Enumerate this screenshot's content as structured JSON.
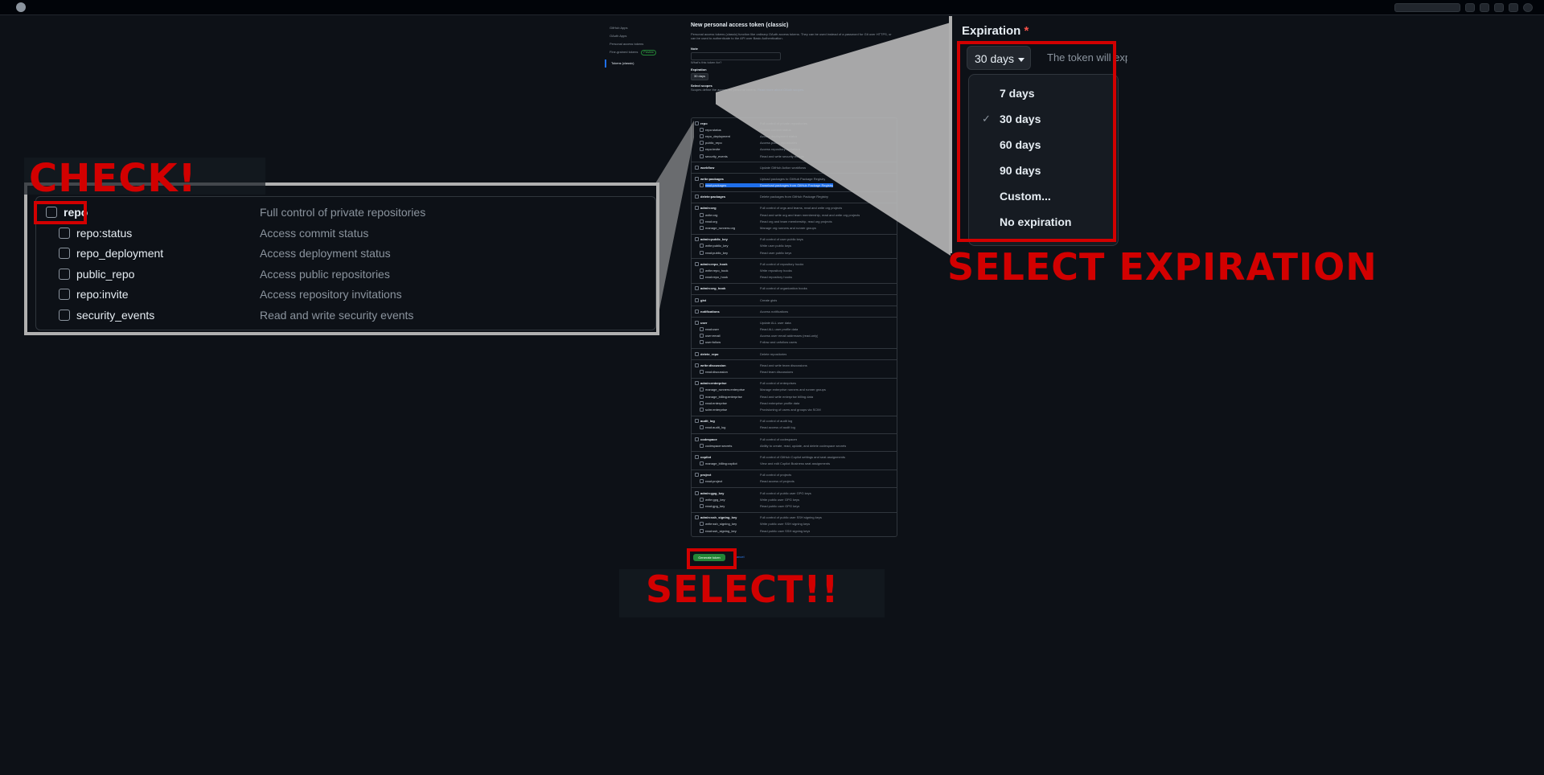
{
  "top_bar": {
    "logo_icon": "github-icon"
  },
  "left_nav": {
    "items": [
      "GitHub Apps",
      "OAuth Apps",
      "Personal access tokens",
      "Fine-grained tokens",
      "Tokens (classic)"
    ],
    "preview_badge": "Preview"
  },
  "form": {
    "heading": "New personal access token (classic)",
    "intro": "Personal access tokens (classic) function like ordinary OAuth access tokens. They can be used instead of a password for Git over HTTPS, or can be used to authenticate to the API over Basic Authentication.",
    "note_label": "Note",
    "note_hint": "What's this token for?",
    "expiration_label": "Expiration",
    "expiration_value": "30 days",
    "select_scopes_label": "Select scopes",
    "scopes_intro": "Scopes define the access for personal tokens.",
    "scopes_link": "Read more about OAuth scopes.",
    "generate_button": "Generate token",
    "cancel_link": "Cancel"
  },
  "scopes": [
    {
      "name": "repo",
      "desc": "Full control of private repositories",
      "children": [
        {
          "name": "repo:status",
          "desc": "Access commit status"
        },
        {
          "name": "repo_deployment",
          "desc": "Access deployment status"
        },
        {
          "name": "public_repo",
          "desc": "Access public repositories"
        },
        {
          "name": "repo:invite",
          "desc": "Access repository invitations"
        },
        {
          "name": "security_events",
          "desc": "Read and write security events"
        }
      ]
    },
    {
      "name": "workflow",
      "desc": "Update GitHub Action workflows",
      "children": []
    },
    {
      "name": "write:packages",
      "desc": "Upload packages to GitHub Package Registry",
      "children": [
        {
          "name": "read:packages",
          "desc": "Download packages from GitHub Package Registry",
          "highlight": true
        }
      ]
    },
    {
      "name": "delete:packages",
      "desc": "Delete packages from GitHub Package Registry",
      "children": []
    },
    {
      "name": "admin:org",
      "desc": "Full control of orgs and teams, read and write org projects",
      "children": [
        {
          "name": "write:org",
          "desc": "Read and write org and team membership, read and write org projects"
        },
        {
          "name": "read:org",
          "desc": "Read org and team membership, read org projects"
        },
        {
          "name": "manage_runners:org",
          "desc": "Manage org runners and runner groups"
        }
      ]
    },
    {
      "name": "admin:public_key",
      "desc": "Full control of user public keys",
      "children": [
        {
          "name": "write:public_key",
          "desc": "Write user public keys"
        },
        {
          "name": "read:public_key",
          "desc": "Read user public keys"
        }
      ]
    },
    {
      "name": "admin:repo_hook",
      "desc": "Full control of repository hooks",
      "children": [
        {
          "name": "write:repo_hook",
          "desc": "Write repository hooks"
        },
        {
          "name": "read:repo_hook",
          "desc": "Read repository hooks"
        }
      ]
    },
    {
      "name": "admin:org_hook",
      "desc": "Full control of organization hooks",
      "children": []
    },
    {
      "name": "gist",
      "desc": "Create gists",
      "children": []
    },
    {
      "name": "notifications",
      "desc": "Access notifications",
      "children": []
    },
    {
      "name": "user",
      "desc": "Update ALL user data",
      "children": [
        {
          "name": "read:user",
          "desc": "Read ALL user profile data"
        },
        {
          "name": "user:email",
          "desc": "Access user email addresses (read-only)"
        },
        {
          "name": "user:follow",
          "desc": "Follow and unfollow users"
        }
      ]
    },
    {
      "name": "delete_repo",
      "desc": "Delete repositories",
      "children": []
    },
    {
      "name": "write:discussion",
      "desc": "Read and write team discussions",
      "children": [
        {
          "name": "read:discussion",
          "desc": "Read team discussions"
        }
      ]
    },
    {
      "name": "admin:enterprise",
      "desc": "Full control of enterprises",
      "children": [
        {
          "name": "manage_runners:enterprise",
          "desc": "Manage enterprise runners and runner groups"
        },
        {
          "name": "manage_billing:enterprise",
          "desc": "Read and write enterprise billing data"
        },
        {
          "name": "read:enterprise",
          "desc": "Read enterprise profile data"
        },
        {
          "name": "scim:enterprise",
          "desc": "Provisioning of users and groups via SCIM"
        }
      ]
    },
    {
      "name": "audit_log",
      "desc": "Full control of audit log",
      "children": [
        {
          "name": "read:audit_log",
          "desc": "Read access of audit log"
        }
      ]
    },
    {
      "name": "codespace",
      "desc": "Full control of codespaces",
      "children": [
        {
          "name": "codespace:secrets",
          "desc": "Ability to create, read, update, and delete codespace secrets"
        }
      ]
    },
    {
      "name": "copilot",
      "desc": "Full control of GitHub Copilot settings and seat assignments",
      "children": [
        {
          "name": "manage_billing:copilot",
          "desc": "View and edit Copilot Business seat assignments"
        }
      ]
    },
    {
      "name": "project",
      "desc": "Full control of projects",
      "children": [
        {
          "name": "read:project",
          "desc": "Read access of projects"
        }
      ]
    },
    {
      "name": "admin:gpg_key",
      "desc": "Full control of public user GPG keys",
      "children": [
        {
          "name": "write:gpg_key",
          "desc": "Write public user GPG keys"
        },
        {
          "name": "read:gpg_key",
          "desc": "Read public user GPG keys"
        }
      ]
    },
    {
      "name": "admin:ssh_signing_key",
      "desc": "Full control of public user SSH signing keys",
      "children": [
        {
          "name": "write:ssh_signing_key",
          "desc": "Write public user SSH signing keys"
        },
        {
          "name": "read:ssh_signing_key",
          "desc": "Read public user SSH signing keys"
        }
      ]
    }
  ],
  "zoom_repo": {
    "rows": [
      {
        "name": "repo",
        "desc": "Full control of private repositories"
      },
      {
        "name": "repo:status",
        "desc": "Access commit status"
      },
      {
        "name": "repo_deployment",
        "desc": "Access deployment status"
      },
      {
        "name": "public_repo",
        "desc": "Access public repositories"
      },
      {
        "name": "repo:invite",
        "desc": "Access repository invitations"
      },
      {
        "name": "security_events",
        "desc": "Read and write security events"
      }
    ]
  },
  "zoom_expiration": {
    "title": "Expiration",
    "required_mark": "*",
    "button_value": "30 days",
    "hint": "The token will exp",
    "options": [
      "7 days",
      "30 days",
      "60 days",
      "90 days",
      "Custom...",
      "No expiration"
    ],
    "selected": "30 days",
    "check_icon": "checkmark-icon"
  },
  "annotations": {
    "check": "CHECK!",
    "select_expiration": "SELECT EXPIRATION",
    "select": "SELECT!!",
    "color": "#d20000"
  }
}
